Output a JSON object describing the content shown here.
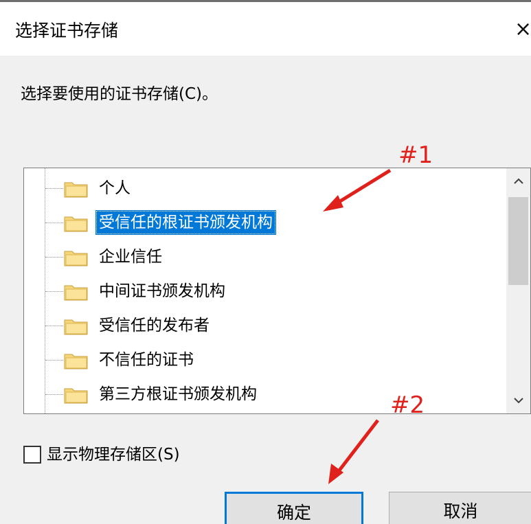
{
  "dialog": {
    "title": "选择证书存储",
    "close_glyph": "×",
    "prompt": "选择要使用的证书存储(C)。"
  },
  "tree": {
    "items": [
      {
        "label": "个人",
        "selected": false
      },
      {
        "label": "受信任的根证书颁发机构",
        "selected": true
      },
      {
        "label": "企业信任",
        "selected": false
      },
      {
        "label": "中间证书颁发机构",
        "selected": false
      },
      {
        "label": "受信任的发布者",
        "selected": false
      },
      {
        "label": "不信任的证书",
        "selected": false
      },
      {
        "label": "第三方根证书颁发机构",
        "selected": false
      }
    ],
    "scroll_up_glyph": "^",
    "scroll_down_glyph": "v",
    "folder_icon": "folder-icon"
  },
  "checkbox": {
    "label": "显示物理存储区(S)",
    "checked": false
  },
  "buttons": {
    "ok_label": "确定",
    "cancel_label": "取消"
  },
  "annotations": {
    "label_1": "#1",
    "label_2": "#2",
    "color": "#e0201a"
  },
  "colors": {
    "selection": "#0078d7",
    "client_bg": "#f0f0f0"
  }
}
